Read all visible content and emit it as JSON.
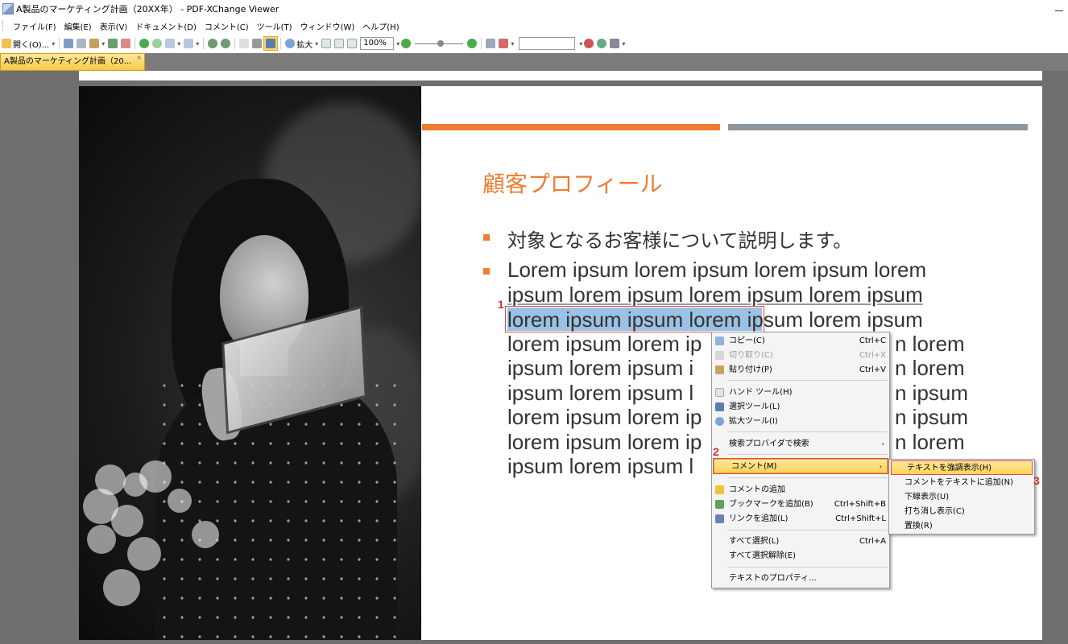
{
  "window": {
    "title": "A製品のマーケティング計画（20XX年） - PDF-XChange Viewer"
  },
  "menubar": [
    "ファイル(F)",
    "編集(E)",
    "表示(V)",
    "ドキュメント(D)",
    "コメント(C)",
    "ツール(T)",
    "ウィンドウ(W)",
    "ヘルプ(H)"
  ],
  "toolbar": {
    "open_label": "開く(O)...",
    "zoom_label": "拡大",
    "zoom_value": "100%"
  },
  "tab": {
    "label": "A製品のマーケティング計画（20...",
    "close": "×"
  },
  "slide": {
    "title": "顧客プロフィール",
    "bullet1": "対象となるお客様について説明します。",
    "lorem_lines": [
      "Lorem ipsum lorem ipsum lorem ipsum lorem",
      "ipsum lorem ipsum lorem ipsum lorem ipsum",
      "lorem ipsum ipsum lorem ipsum lorem ipsum",
      "lorem ipsum lorem ip",
      "ipsum lorem ipsum i",
      "ipsum lorem ipsum l",
      "lorem ipsum lorem ip",
      "lorem ipsum lorem ip",
      "ipsum lorem ipsum l"
    ],
    "lorem_tails": [
      "n lorem",
      "n lorem",
      "n ipsum",
      "n ipsum",
      "n lorem"
    ],
    "selected_text": "lorem ipsum ipsum lorem"
  },
  "steps": [
    "1",
    "2",
    "3"
  ],
  "context_menu": {
    "copy": {
      "label": "コピー(C)",
      "shortcut": "Ctrl+C"
    },
    "cut": {
      "label": "切り取り(C)",
      "shortcut": "Ctrl+X"
    },
    "paste": {
      "label": "貼り付け(P)",
      "shortcut": "Ctrl+V"
    },
    "hand_tool": {
      "label": "ハンド ツール(H)"
    },
    "select_tool": {
      "label": "選択ツール(L)"
    },
    "zoom_tool": {
      "label": "拡大ツール(I)"
    },
    "search_provider": {
      "label": "検索プロバイダで検索"
    },
    "comment": {
      "label": "コメント(M)"
    },
    "add_comment": {
      "label": "コメントの追加"
    },
    "add_bookmark": {
      "label": "ブックマークを追加(B)",
      "shortcut": "Ctrl+Shift+B"
    },
    "add_link": {
      "label": "リンクを追加(L)",
      "shortcut": "Ctrl+Shift+L"
    },
    "select_all": {
      "label": "すべて選択(L)",
      "shortcut": "Ctrl+A"
    },
    "deselect_all": {
      "label": "すべて選択解除(E)"
    },
    "text_properties": {
      "label": "テキストのプロパティ..."
    }
  },
  "sub_menu": {
    "highlight": "テキストを強調表示(H)",
    "add_comment_to_text": "コメントをテキストに追加(N)",
    "underline": "下線表示(U)",
    "strikethrough": "打ち消し表示(C)",
    "replace": "置換(R)"
  },
  "colors": {
    "accent": "#ed7d31",
    "selection": "#9bc1e4",
    "step": "#d32f2f"
  }
}
